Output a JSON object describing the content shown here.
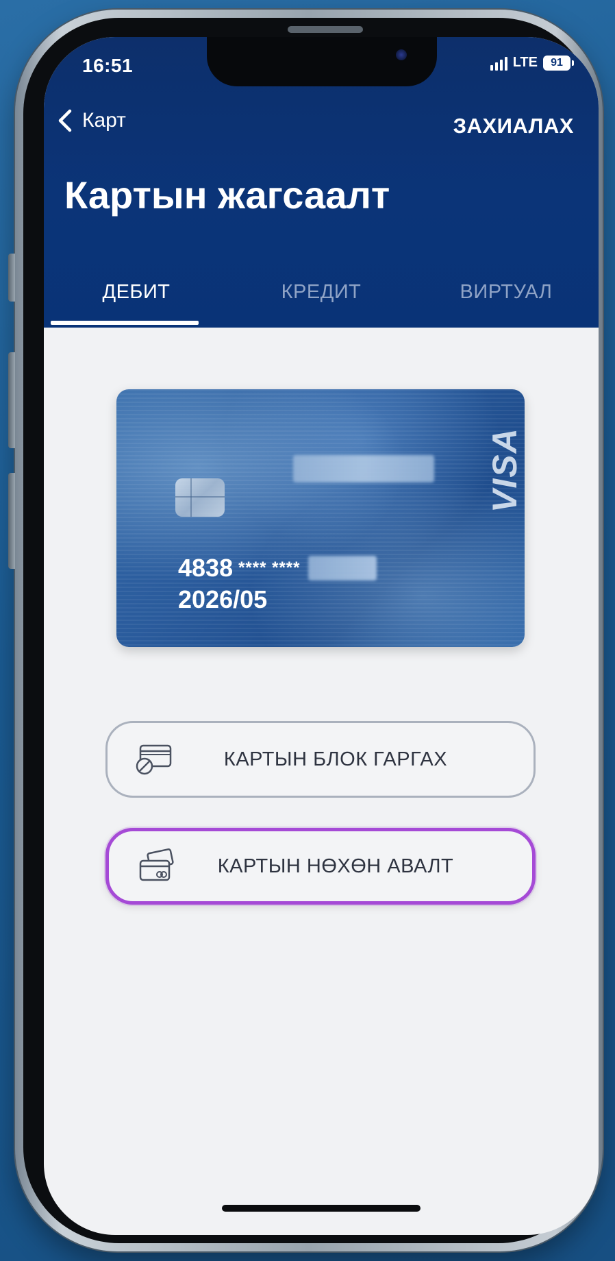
{
  "status_bar": {
    "time": "16:51",
    "network": "LTE",
    "battery": "91"
  },
  "nav": {
    "back_label": "Карт",
    "order_label": "ЗАХИАЛАХ"
  },
  "page": {
    "title": "Картын жагсаалт"
  },
  "tabs": [
    {
      "label": "ДЕБИТ",
      "active": true
    },
    {
      "label": "КРЕДИТ",
      "active": false
    },
    {
      "label": "ВИРТУАЛ",
      "active": false
    }
  ],
  "card": {
    "brand": "VISA",
    "number_prefix": "4838",
    "number_masked": "**** ****",
    "expiry": "2026/05"
  },
  "actions": {
    "block_label": "КАРТЫН БЛОК ГАРГАХ",
    "reorder_label": "КАРТЫН НӨХӨН АВАЛТ"
  },
  "colors": {
    "header_bg": "#0b3478",
    "screen_bg": "#f1f2f4",
    "highlight_border": "#a54ad6",
    "inactive_tab": "#8fa3c6"
  }
}
